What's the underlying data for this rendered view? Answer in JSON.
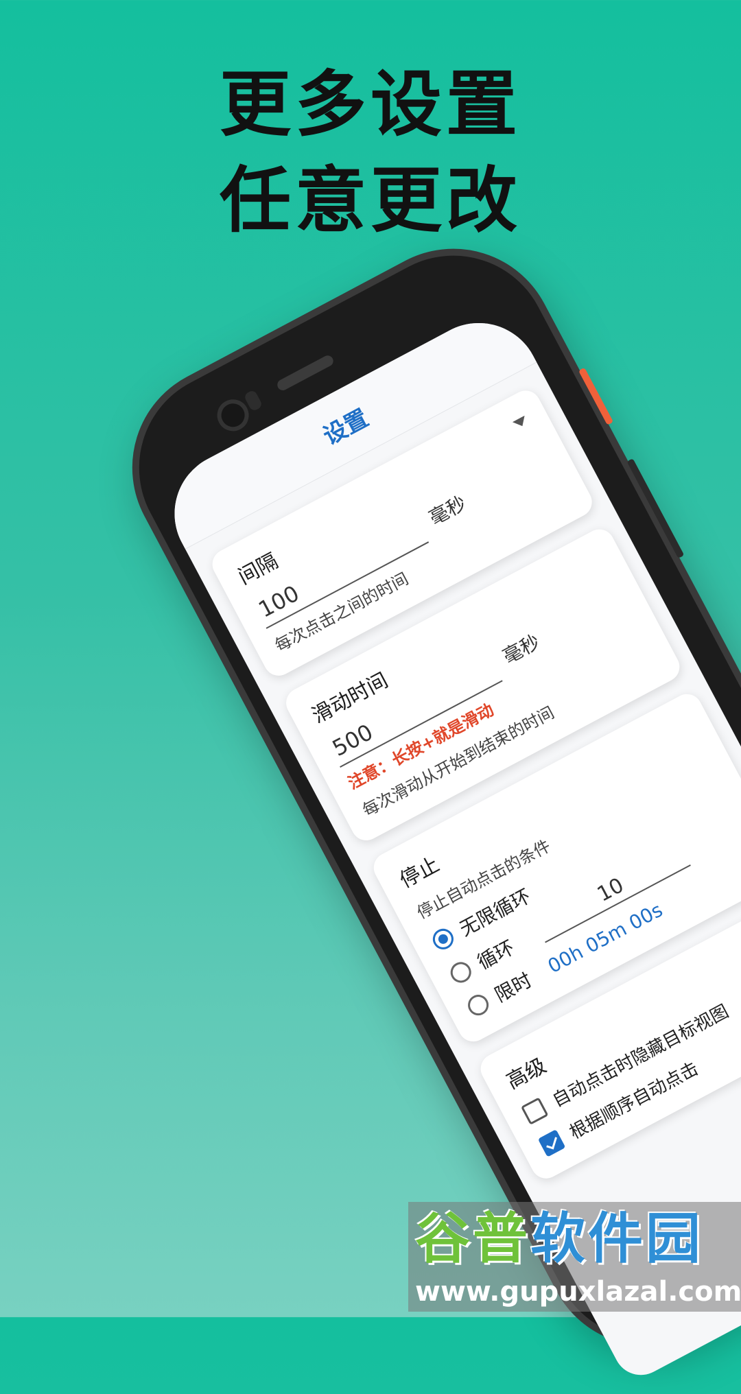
{
  "headline": {
    "line1": "更多设置",
    "line2": "任意更改"
  },
  "app": {
    "title": "设置",
    "click_interval": {
      "unit": "毫秒",
      "value": "100",
      "hint": "每次点击之间的时间",
      "title": "间隔"
    },
    "swipe_time": {
      "unit": "毫秒",
      "value": "500",
      "warning": "注意：长按+就是滑动",
      "hint": "每次滑动从开始到结束的时间",
      "title": "滑动时间"
    },
    "stop": {
      "loop_label": "循环",
      "time_value": "00h 05m 00s",
      "timed_label": "限时",
      "count_value": "10",
      "infinite_label": "无限循环",
      "hint": "停止自动点击的条件",
      "title": "停止"
    },
    "advanced": {
      "title": "高级",
      "hide_views_label": "自动点击时隐藏目标视图",
      "order_label": "根据顺序自动点击"
    }
  },
  "watermark": {
    "logo_green": "谷普",
    "logo_blue": "软件园",
    "url": "www.gupuxlazal.com"
  },
  "colors": {
    "background": "#14bf9e",
    "accent": "#1f6fc6",
    "warning": "#e0472a"
  }
}
